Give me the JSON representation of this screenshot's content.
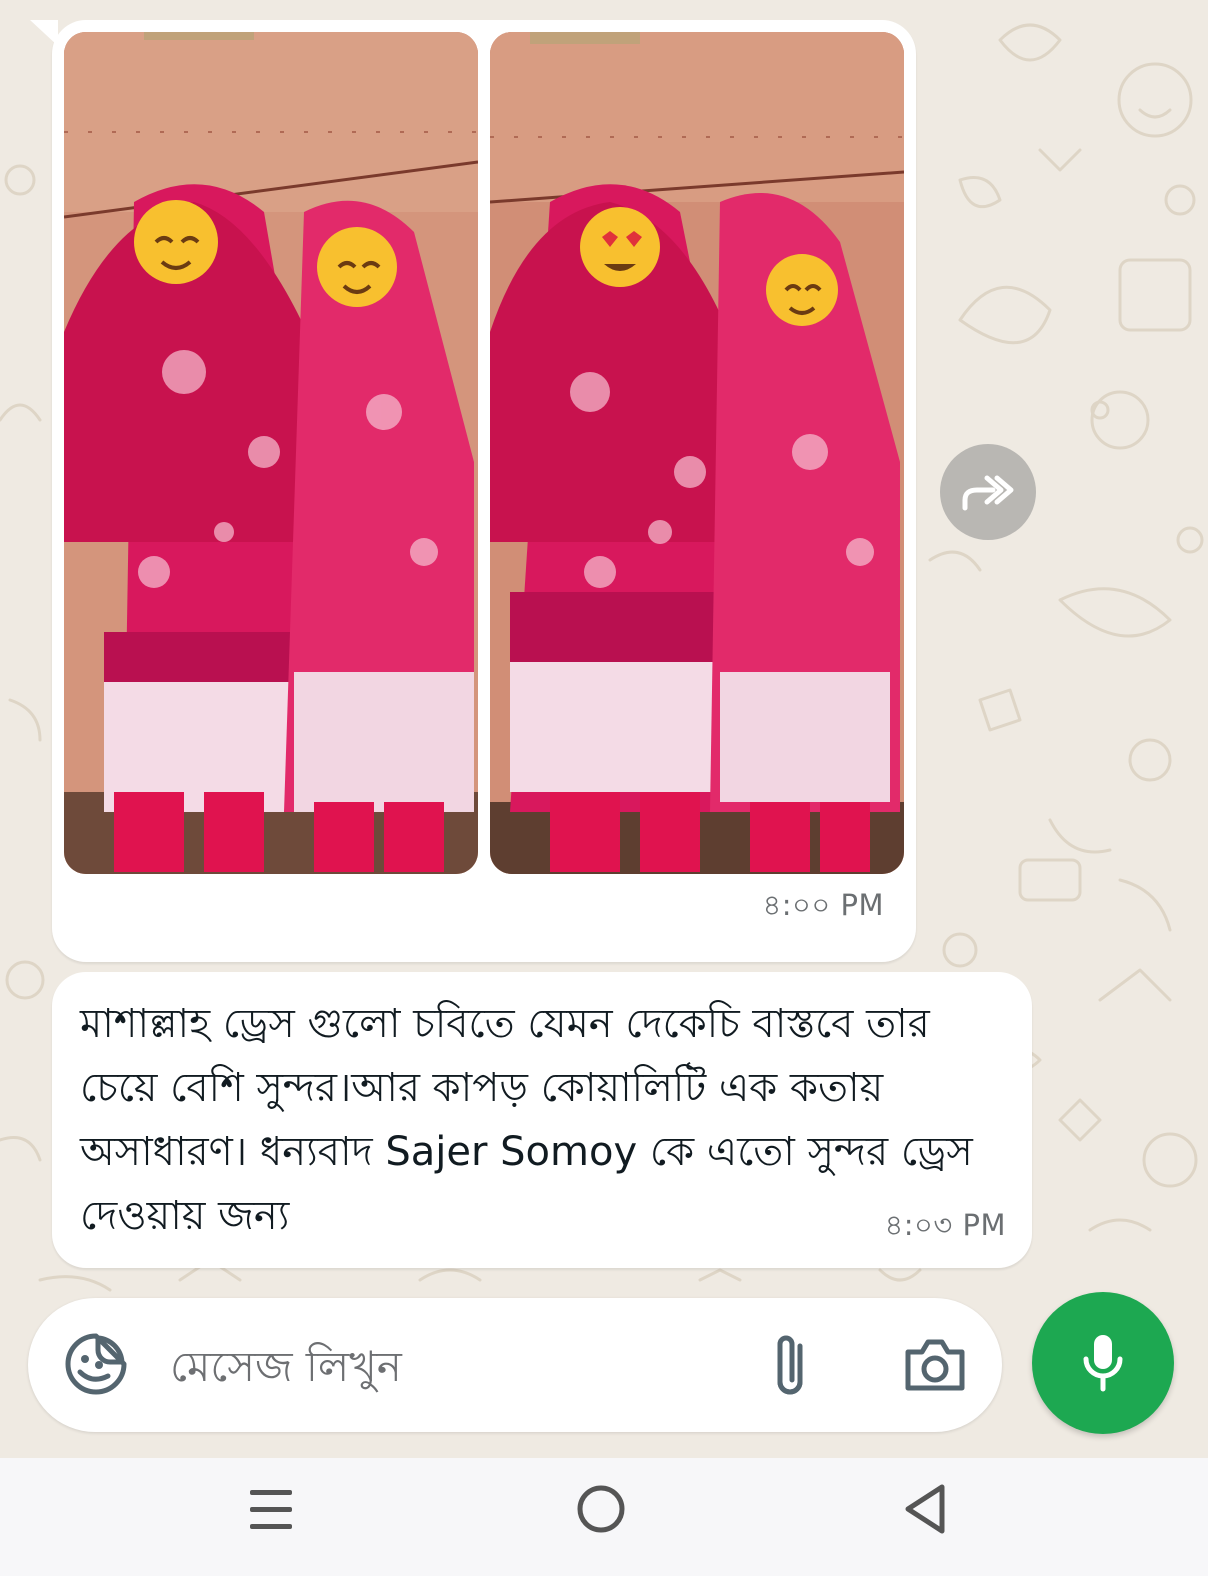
{
  "colors": {
    "chat_background": "#efeae2",
    "bubble": "#ffffff",
    "mic_button": "#1da851",
    "timestamp": "#6b6f72",
    "nav_bar": "#f7f7f9"
  },
  "messages": [
    {
      "type": "images",
      "direction": "incoming",
      "images": [
        {
          "icon": "photo-two-women-in-pink-salwar-kameez"
        },
        {
          "icon": "photo-two-women-in-pink-salwar-kameez"
        }
      ],
      "time": "৪:০০ PM"
    },
    {
      "type": "text",
      "direction": "incoming",
      "text": "মাশাল্লাহ ড্রেস গুলো চবিতে যেমন দেকেচি বাস্তবে তার চেয়ে বেশি সুন্দর।আর কাপড় কোয়ালিটি এক কতায় অসাধারণ। ধন্যবাদ Sajer Somoy কে এতো সুন্দর ড্রেস দেওয়ায় জন্য",
      "time": "৪:০৩ PM"
    }
  ],
  "composer": {
    "placeholder": "মেসেজ লিখুন",
    "sticker_icon": "sticker-icon",
    "attach_icon": "paperclip-icon",
    "camera_icon": "camera-icon",
    "mic_icon": "microphone-icon"
  },
  "forward_icon": "forward-icon",
  "system_nav": {
    "recents_icon": "recents-icon",
    "home_icon": "home-icon",
    "back_icon": "back-icon"
  }
}
